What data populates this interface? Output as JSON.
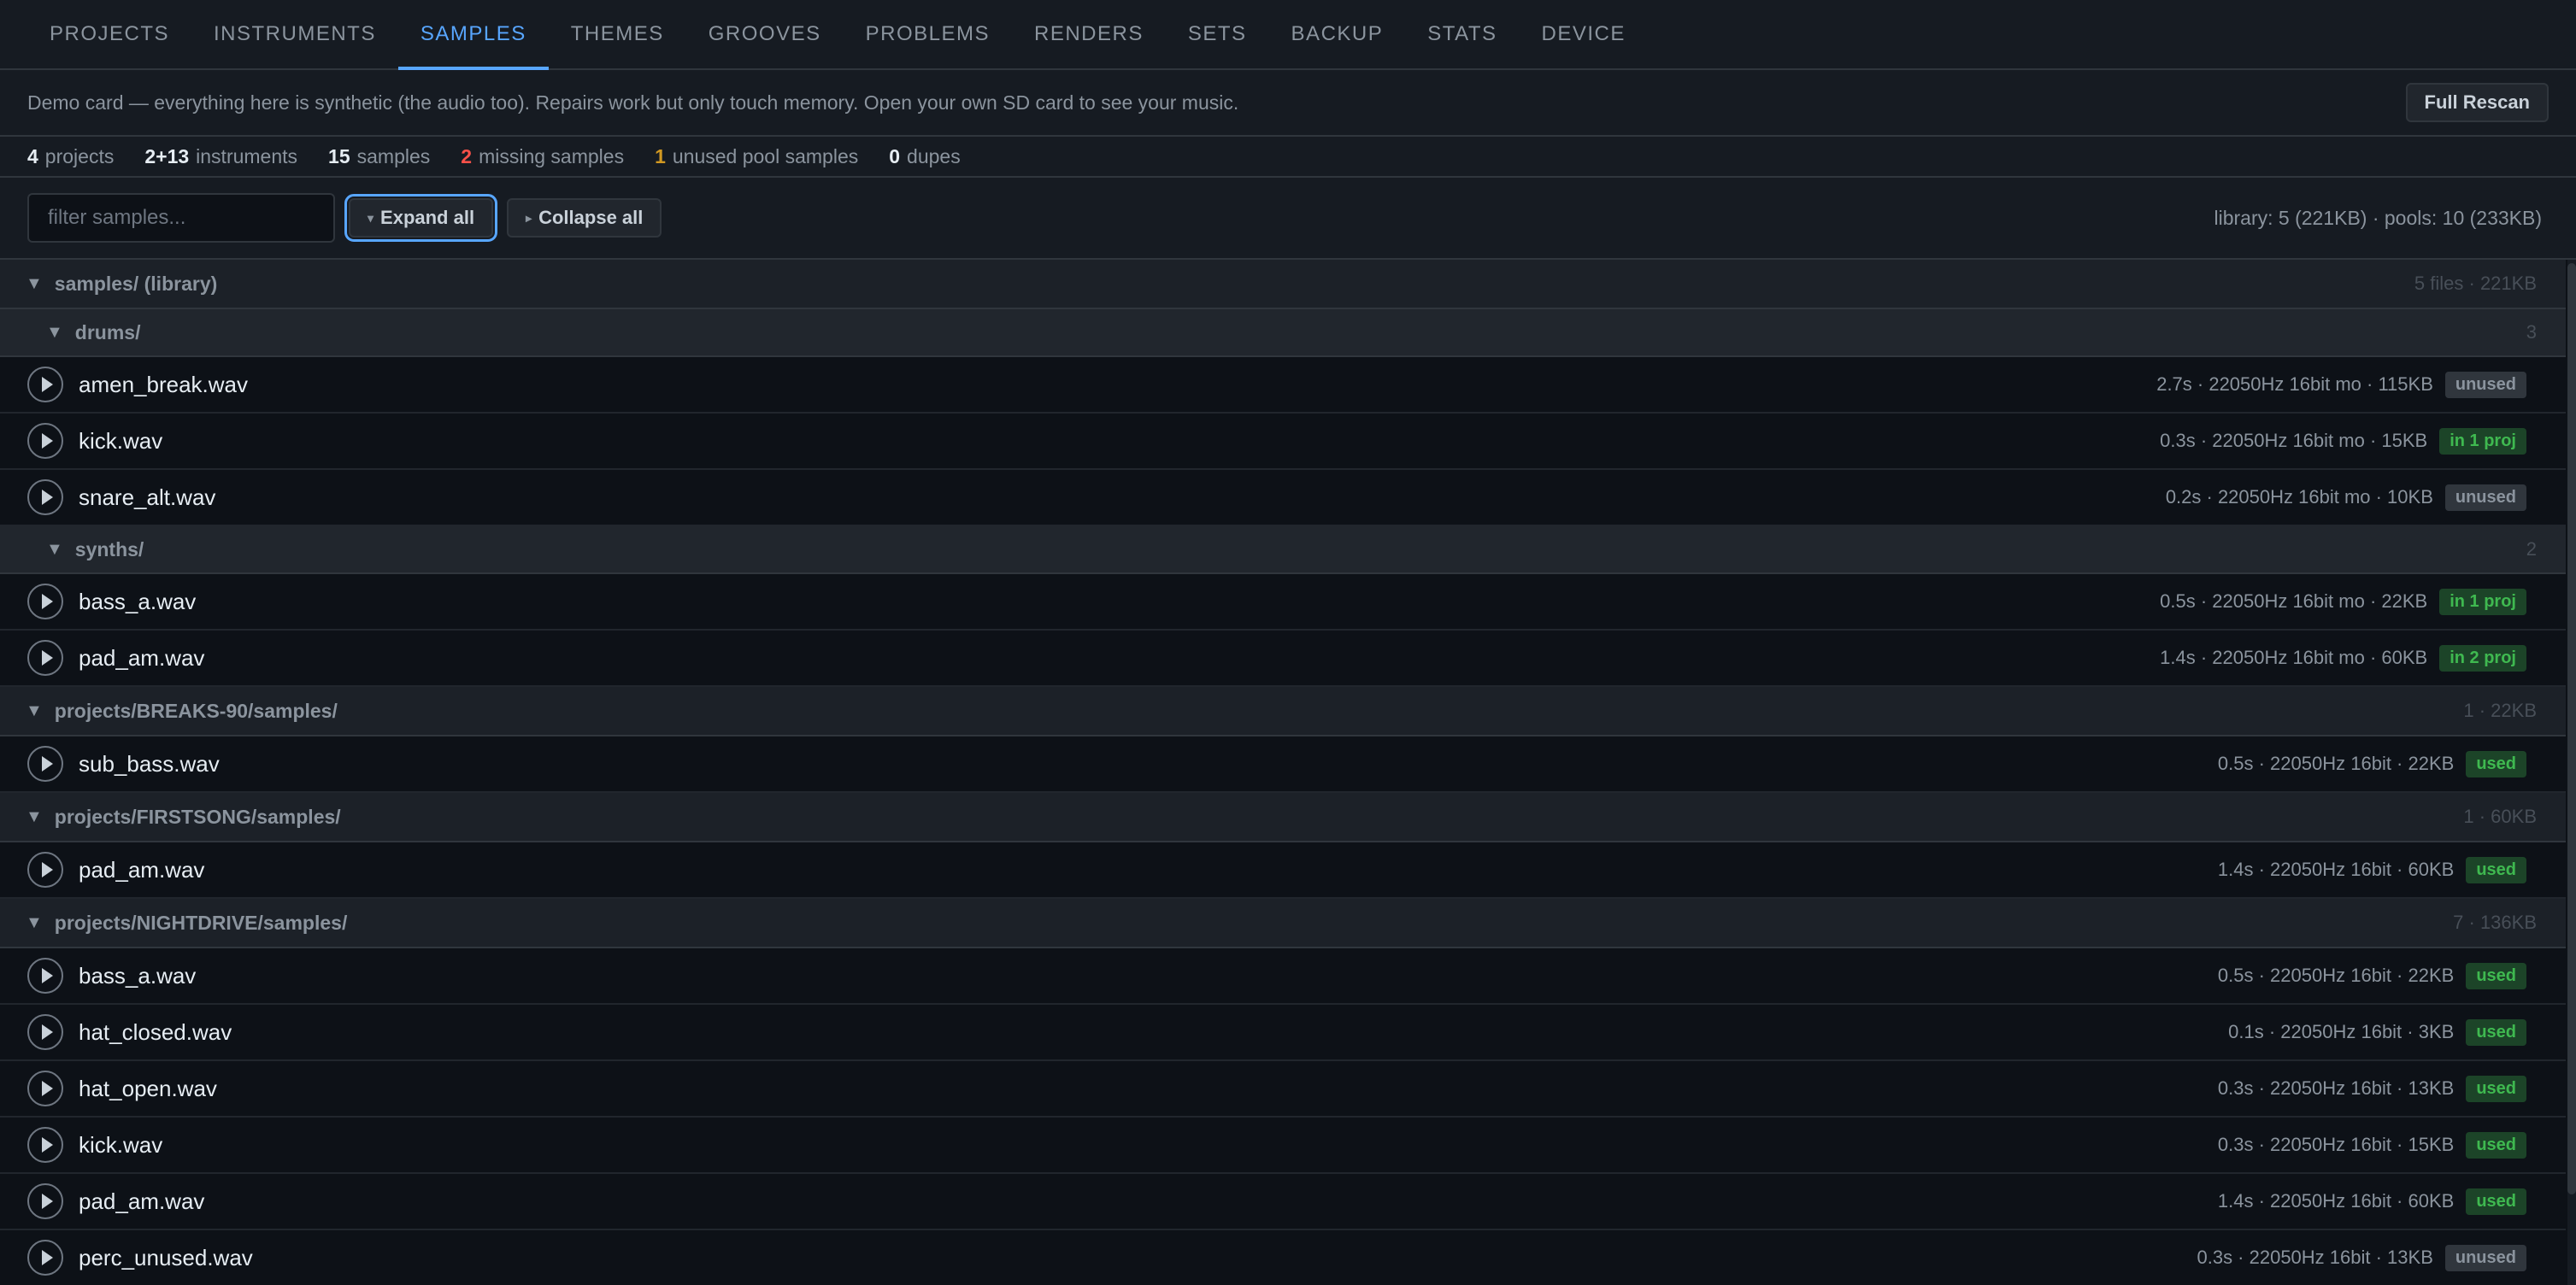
{
  "nav": {
    "tabs": [
      {
        "label": "PROJECTS"
      },
      {
        "label": "INSTRUMENTS"
      },
      {
        "label": "SAMPLES",
        "active": true
      },
      {
        "label": "THEMES"
      },
      {
        "label": "GROOVES"
      },
      {
        "label": "PROBLEMS"
      },
      {
        "label": "RENDERS"
      },
      {
        "label": "SETS"
      },
      {
        "label": "BACKUP"
      },
      {
        "label": "STATS"
      },
      {
        "label": "DEVICE"
      }
    ]
  },
  "banner": {
    "text": "Demo card — everything here is synthetic (the audio too). Repairs work but only touch memory. Open your own SD card to see your music.",
    "rescan_label": "Full Rescan"
  },
  "stats": [
    {
      "value": "4",
      "label": "projects",
      "kind": "normal"
    },
    {
      "value": "2+13",
      "label": "instruments",
      "kind": "normal"
    },
    {
      "value": "15",
      "label": "samples",
      "kind": "normal"
    },
    {
      "value": "2",
      "label": "missing samples",
      "kind": "warn"
    },
    {
      "value": "1",
      "label": "unused pool samples",
      "kind": "info"
    },
    {
      "value": "0",
      "label": "dupes",
      "kind": "normal"
    }
  ],
  "toolbar": {
    "filter_placeholder": "filter samples...",
    "expand_label": "Expand all",
    "collapse_label": "Collapse all",
    "summary": "library: 5 (221KB) · pools: 10 (233KB)"
  },
  "groups": [
    {
      "title": "samples/ (library)",
      "right": "5 files · 221KB",
      "folders": [
        {
          "title": "drums/",
          "right": "3",
          "rows": [
            {
              "name": "amen_break.wav",
              "meta": "2.7s · 22050Hz 16bit mo · 115KB",
              "badge": "unused",
              "badge_kind": "unused"
            },
            {
              "name": "kick.wav",
              "meta": "0.3s · 22050Hz 16bit mo · 15KB",
              "badge": "in 1 proj",
              "badge_kind": "inproj"
            },
            {
              "name": "snare_alt.wav",
              "meta": "0.2s · 22050Hz 16bit mo · 10KB",
              "badge": "unused",
              "badge_kind": "unused"
            }
          ]
        },
        {
          "title": "synths/",
          "right": "2",
          "rows": [
            {
              "name": "bass_a.wav",
              "meta": "0.5s · 22050Hz 16bit mo · 22KB",
              "badge": "in 1 proj",
              "badge_kind": "inproj"
            },
            {
              "name": "pad_am.wav",
              "meta": "1.4s · 22050Hz 16bit mo · 60KB",
              "badge": "in 2 proj",
              "badge_kind": "inproj"
            }
          ]
        }
      ]
    },
    {
      "title": "projects/BREAKS-90/samples/",
      "right": "1 · 22KB",
      "rows": [
        {
          "name": "sub_bass.wav",
          "meta": "0.5s · 22050Hz 16bit · 22KB",
          "badge": "used",
          "badge_kind": "used"
        }
      ]
    },
    {
      "title": "projects/FIRSTSONG/samples/",
      "right": "1 · 60KB",
      "rows": [
        {
          "name": "pad_am.wav",
          "meta": "1.4s · 22050Hz 16bit · 60KB",
          "badge": "used",
          "badge_kind": "used"
        }
      ]
    },
    {
      "title": "projects/NIGHTDRIVE/samples/",
      "right": "7 · 136KB",
      "rows": [
        {
          "name": "bass_a.wav",
          "meta": "0.5s · 22050Hz 16bit · 22KB",
          "badge": "used",
          "badge_kind": "used"
        },
        {
          "name": "hat_closed.wav",
          "meta": "0.1s · 22050Hz 16bit · 3KB",
          "badge": "used",
          "badge_kind": "used"
        },
        {
          "name": "hat_open.wav",
          "meta": "0.3s · 22050Hz 16bit · 13KB",
          "badge": "used",
          "badge_kind": "used"
        },
        {
          "name": "kick.wav",
          "meta": "0.3s · 22050Hz 16bit · 15KB",
          "badge": "used",
          "badge_kind": "used"
        },
        {
          "name": "pad_am.wav",
          "meta": "1.4s · 22050Hz 16bit · 60KB",
          "badge": "used",
          "badge_kind": "used"
        },
        {
          "name": "perc_unused.wav",
          "meta": "0.3s · 22050Hz 16bit · 13KB",
          "badge": "unused",
          "badge_kind": "unused"
        }
      ]
    }
  ],
  "icons": {
    "collapse": "triangle-down-icon",
    "play": "play-icon"
  }
}
